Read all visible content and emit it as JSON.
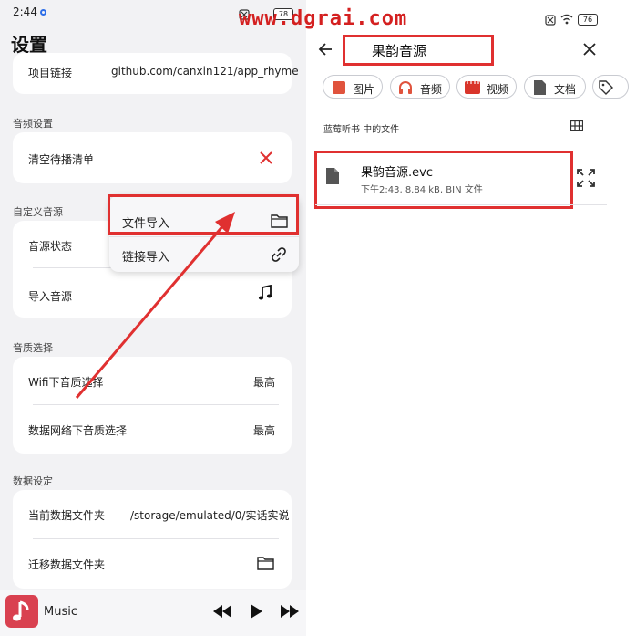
{
  "status_bar": {
    "time": "2:44",
    "battery_left": "78",
    "battery_right": "76"
  },
  "watermark": "www.dgrai.com",
  "settings": {
    "title": "设置",
    "project_link": {
      "label": "项目链接",
      "value": "github.com/canxin121/app_rhyme"
    },
    "audio_settings": {
      "section": "音频设置",
      "clear_queue": "清空待播清单"
    },
    "custom_source": {
      "section": "自定义音源",
      "source_status": "音源状态",
      "import_source": "导入音源"
    },
    "quality": {
      "section": "音质选择",
      "wifi_label": "Wifi下音质选择",
      "wifi_value": "最高",
      "mobile_label": "数据网络下音质选择",
      "mobile_value": "最高"
    },
    "data_settings": {
      "section": "数据设定",
      "current_folder_label": "当前数据文件夹",
      "current_folder_value": "/storage/emulated/0/实话实说",
      "migrate_folder": "迁移数据文件夹"
    },
    "popup": {
      "file_import": "文件导入",
      "link_import": "链接导入"
    },
    "music_bar": {
      "title": "Music"
    }
  },
  "file_picker": {
    "search_query": "果韵音源",
    "chips": [
      {
        "label": "图片",
        "icon": "image-icon"
      },
      {
        "label": "音频",
        "icon": "headphones-icon"
      },
      {
        "label": "视频",
        "icon": "video-icon"
      },
      {
        "label": "文档",
        "icon": "document-icon"
      }
    ],
    "location_label": "蓝莓听书 中的文件",
    "file": {
      "name": "果韵音源.evc",
      "meta": "下午2:43, 8.84 kB, BIN 文件"
    }
  },
  "colors": {
    "accent_red": "#e03030",
    "watermark_red": "#d42020",
    "panel_bg": "#f2f2f4",
    "card_bg": "#ffffff"
  }
}
